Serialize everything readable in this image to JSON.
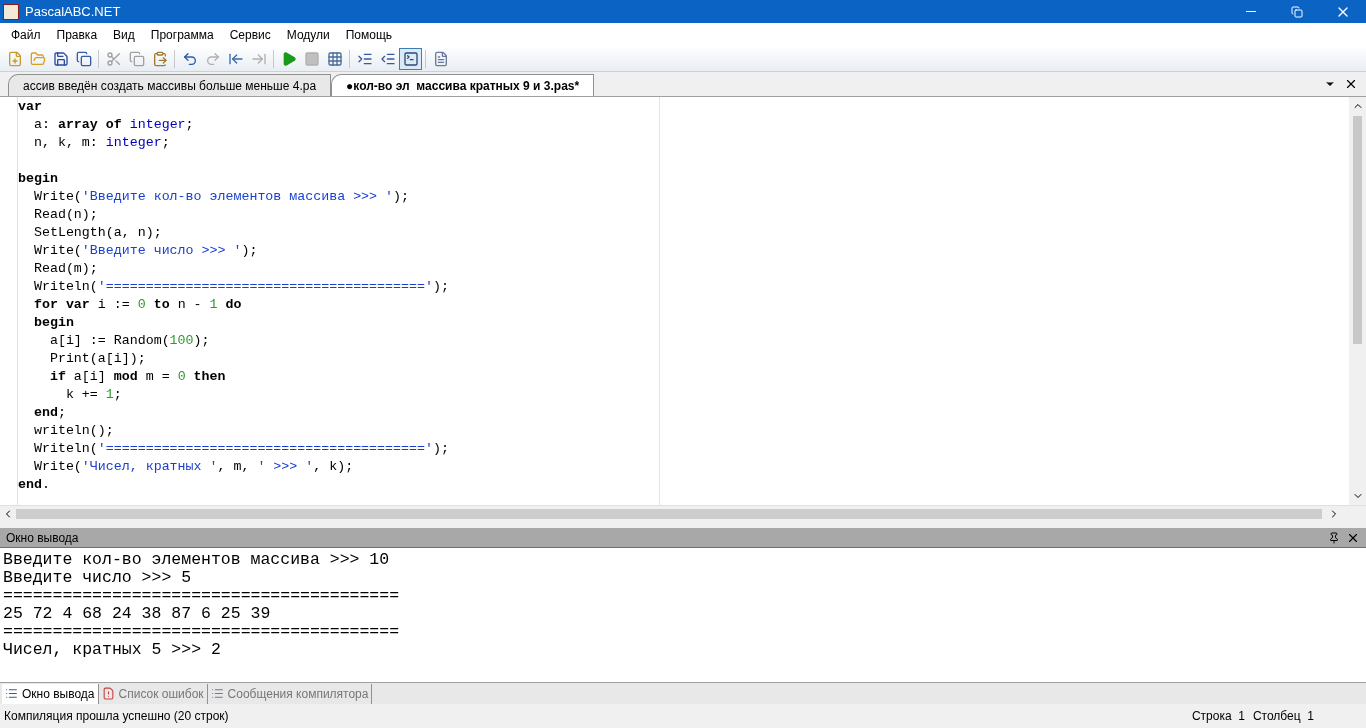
{
  "window": {
    "title": "PascalABC.NET"
  },
  "menu": [
    "Файл",
    "Правка",
    "Вид",
    "Программа",
    "Сервис",
    "Модули",
    "Помощь"
  ],
  "tabs": [
    {
      "label": "ассив введён создать массивы больше меньше 4.pa",
      "selected": false
    },
    {
      "label": "●кол-во эл  массива кратных 9 и 3.pas*",
      "selected": true
    }
  ],
  "code_lines": [
    {
      "kind": "code",
      "tokens": [
        {
          "text": "var",
          "kind": "keyword"
        }
      ]
    },
    {
      "kind": "code",
      "tokens": [
        {
          "text": "  a: ",
          "kind": "plain"
        },
        {
          "text": "array of",
          "kind": "keyword"
        },
        {
          "text": " integer",
          "kind": "type"
        },
        {
          "text": ";",
          "kind": "plain"
        }
      ]
    },
    {
      "kind": "code",
      "tokens": [
        {
          "text": "  n, k, m: ",
          "kind": "plain"
        },
        {
          "text": "integer",
          "kind": "type"
        },
        {
          "text": ";",
          "kind": "plain"
        }
      ]
    },
    {
      "kind": "blank"
    },
    {
      "kind": "code",
      "tokens": [
        {
          "text": "begin",
          "kind": "keyword"
        }
      ]
    },
    {
      "kind": "code",
      "tokens": [
        {
          "text": "  Write(",
          "kind": "plain"
        },
        {
          "text": "'Введите кол-во элементов массива >>> '",
          "kind": "string"
        },
        {
          "text": ");",
          "kind": "plain"
        }
      ]
    },
    {
      "kind": "code",
      "tokens": [
        {
          "text": "  Read(n);",
          "kind": "plain"
        }
      ]
    },
    {
      "kind": "code",
      "tokens": [
        {
          "text": "  SetLength(a, n);",
          "kind": "plain"
        }
      ]
    },
    {
      "kind": "code",
      "tokens": [
        {
          "text": "  Write(",
          "kind": "plain"
        },
        {
          "text": "'Введите число >>> '",
          "kind": "string"
        },
        {
          "text": ");",
          "kind": "plain"
        }
      ]
    },
    {
      "kind": "code",
      "tokens": [
        {
          "text": "  Read(m);",
          "kind": "plain"
        }
      ]
    },
    {
      "kind": "code",
      "tokens": [
        {
          "text": "  Writeln(",
          "kind": "plain"
        },
        {
          "text": "'========================================'",
          "kind": "string"
        },
        {
          "text": ");",
          "kind": "plain"
        }
      ]
    },
    {
      "kind": "code",
      "tokens": [
        {
          "text": "  for var",
          "kind": "keyword"
        },
        {
          "text": " i := ",
          "kind": "plain"
        },
        {
          "text": "0",
          "kind": "number"
        },
        {
          "text": " to",
          "kind": "keyword"
        },
        {
          "text": " n - ",
          "kind": "plain"
        },
        {
          "text": "1",
          "kind": "number"
        },
        {
          "text": " do",
          "kind": "keyword"
        }
      ]
    },
    {
      "kind": "code",
      "tokens": [
        {
          "text": "  begin",
          "kind": "keyword"
        }
      ]
    },
    {
      "kind": "code",
      "tokens": [
        {
          "text": "    a[i] := Random(",
          "kind": "plain"
        },
        {
          "text": "100",
          "kind": "number"
        },
        {
          "text": ");",
          "kind": "plain"
        }
      ]
    },
    {
      "kind": "code",
      "tokens": [
        {
          "text": "    Print(a[i]);",
          "kind": "plain"
        }
      ]
    },
    {
      "kind": "code",
      "tokens": [
        {
          "text": "    if",
          "kind": "keyword"
        },
        {
          "text": " a[i] ",
          "kind": "plain"
        },
        {
          "text": "mod",
          "kind": "keyword"
        },
        {
          "text": " m = ",
          "kind": "plain"
        },
        {
          "text": "0",
          "kind": "number"
        },
        {
          "text": " then",
          "kind": "keyword"
        }
      ]
    },
    {
      "kind": "code",
      "tokens": [
        {
          "text": "      k += ",
          "kind": "plain"
        },
        {
          "text": "1",
          "kind": "number"
        },
        {
          "text": ";",
          "kind": "plain"
        }
      ]
    },
    {
      "kind": "code",
      "tokens": [
        {
          "text": "  end",
          "kind": "keyword"
        },
        {
          "text": ";",
          "kind": "plain"
        }
      ]
    },
    {
      "kind": "code",
      "tokens": [
        {
          "text": "  writeln();",
          "kind": "plain"
        }
      ]
    },
    {
      "kind": "code",
      "tokens": [
        {
          "text": "  Writeln(",
          "kind": "plain"
        },
        {
          "text": "'========================================'",
          "kind": "string"
        },
        {
          "text": ");",
          "kind": "plain"
        }
      ]
    },
    {
      "kind": "code",
      "tokens": [
        {
          "text": "  Write(",
          "kind": "plain"
        },
        {
          "text": "'Чисел, кратных '",
          "kind": "string"
        },
        {
          "text": ", m, ",
          "kind": "plain"
        },
        {
          "text": "' >>> '",
          "kind": "string"
        },
        {
          "text": ", k);",
          "kind": "plain"
        }
      ]
    },
    {
      "kind": "code",
      "tokens": [
        {
          "text": "end",
          "kind": "keyword"
        },
        {
          "text": ".",
          "kind": "plain"
        }
      ]
    }
  ],
  "output_panel": {
    "title": "Окно вывода",
    "lines": [
      "Введите кол-во элементов массива >>> 10",
      "Введите число >>> 5",
      "========================================",
      "25 72 4 68 24 38 87 6 25 39",
      "========================================",
      "Чисел, кратных 5 >>> 2"
    ]
  },
  "bottom_tabs": [
    {
      "label": "Окно вывода",
      "selected": true,
      "kind": "output"
    },
    {
      "label": "Список ошибок",
      "selected": false,
      "kind": "errors"
    },
    {
      "label": "Сообщения компилятора",
      "selected": false,
      "kind": "messages"
    }
  ],
  "status_bar": {
    "message": "Компиляция прошла успешно (20 строк)",
    "line": "Строка  1",
    "column": "Столбец  1"
  }
}
